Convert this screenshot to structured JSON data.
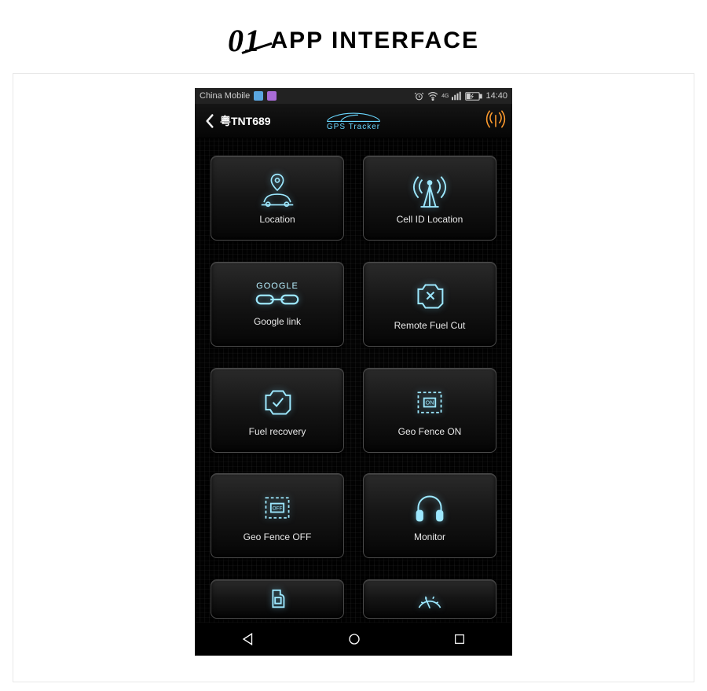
{
  "page_header": {
    "number": "01",
    "title": "APP INTERFACE"
  },
  "statusbar": {
    "carrier": "China Mobile",
    "network_badge": "4G",
    "time": "14:40"
  },
  "appbar": {
    "device_name": "粤TNT689",
    "brand": "GPS Tracker"
  },
  "tiles": [
    {
      "icon": "location-car-icon",
      "label": "Location"
    },
    {
      "icon": "cell-tower-icon",
      "label": "Cell ID Location"
    },
    {
      "icon": "google-link-icon",
      "label": "Google link",
      "sub": "GOOGLE"
    },
    {
      "icon": "fuel-cut-icon",
      "label": "Remote Fuel Cut"
    },
    {
      "icon": "fuel-ok-icon",
      "label": "Fuel recovery"
    },
    {
      "icon": "fence-on-icon",
      "label": "Geo Fence ON",
      "badge": "ON"
    },
    {
      "icon": "fence-off-icon",
      "label": "Geo Fence OFF",
      "badge": "OFF"
    },
    {
      "icon": "headphones-icon",
      "label": "Monitor"
    }
  ],
  "colors": {
    "accent": "#6ad7ff",
    "signal": "#ff9b2d"
  }
}
